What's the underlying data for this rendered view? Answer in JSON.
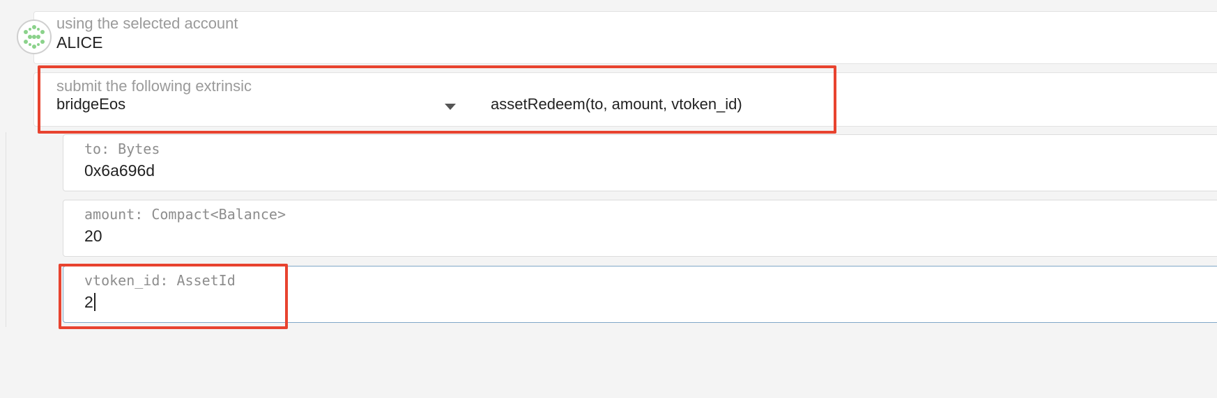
{
  "account": {
    "label": "using the selected account",
    "name": "ALICE"
  },
  "extrinsic": {
    "label": "submit the following extrinsic",
    "module": "bridgeEos",
    "method": "assetRedeem(to, amount, vtoken_id)"
  },
  "params": [
    {
      "label": "to: Bytes",
      "value": "0x6a696d"
    },
    {
      "label": "amount: Compact<Balance>",
      "value": "20"
    },
    {
      "label": "vtoken_id: AssetId",
      "value": "2"
    }
  ],
  "colors": {
    "highlight": "#e8432f",
    "focus_border": "#7fa6c7",
    "avatar_dots": "#8bd28b"
  }
}
